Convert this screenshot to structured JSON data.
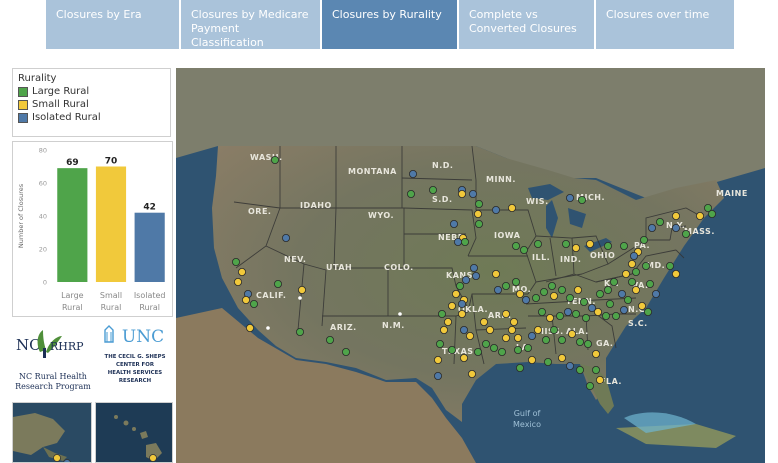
{
  "tabs": [
    {
      "label": "Closures by Era",
      "active": false
    },
    {
      "label": "Closures by Medicare Payment Classification",
      "active": false
    },
    {
      "label": "Closures by Rurality",
      "active": true
    },
    {
      "label": "Complete vs Converted Closures",
      "active": false
    },
    {
      "label": "Closures over time",
      "active": false
    }
  ],
  "legend": {
    "title": "Rurality",
    "items": [
      {
        "label": "Large Rural",
        "color": "#4fa44a"
      },
      {
        "label": "Small Rural",
        "color": "#f1c93b"
      },
      {
        "label": "Isolated Rural",
        "color": "#4f79a7"
      }
    ]
  },
  "chart_data": {
    "type": "bar",
    "categories": [
      "Large Rural",
      "Small Rural",
      "Isolated Rural"
    ],
    "values": [
      69,
      70,
      42
    ],
    "colors": [
      "#4fa44a",
      "#f1c93b",
      "#4f79a7"
    ],
    "ylabel": "Number of Closures",
    "ylim": [
      0,
      80
    ],
    "yticks": [
      0,
      20,
      40,
      60,
      80
    ],
    "grid": false
  },
  "logos": {
    "ncrhrp": {
      "title_left": "NC",
      "title_right": "RHRP",
      "subtitle_line1": "NC Rural Health",
      "subtitle_line2": "Research Program"
    },
    "unc": {
      "mark": "UNC",
      "line1": "THE CECIL G. SHEPS",
      "line2": "CENTER FOR",
      "line3": "HEALTH SERVICES",
      "line4": "RESEARCH"
    }
  },
  "map": {
    "state_labels": [
      "WASH.",
      "MONTANA",
      "N.D.",
      "MINN.",
      "ORE.",
      "IDAHO",
      "S.D.",
      "WIS.",
      "MICH.",
      "WYO.",
      "IOWA",
      "NEBR.",
      "MAINE",
      "NEV.",
      "UTAH",
      "COLO.",
      "KANS.",
      "ILL.",
      "IND.",
      "OHIO",
      "PA.",
      "N.Y.",
      "MASS.",
      "CALIF.",
      "ARIZ.",
      "N.M.",
      "OKLA.",
      "MO.",
      "KY.",
      "VA.",
      "MD.",
      "TENN.",
      "ARK.",
      "N.C.",
      "TEXAS",
      "LA.",
      "MISS.",
      "ALA.",
      "GA.",
      "S.C.",
      "FLA."
    ],
    "water_label_line1": "Gulf of",
    "water_label_line2": "Mexico"
  }
}
